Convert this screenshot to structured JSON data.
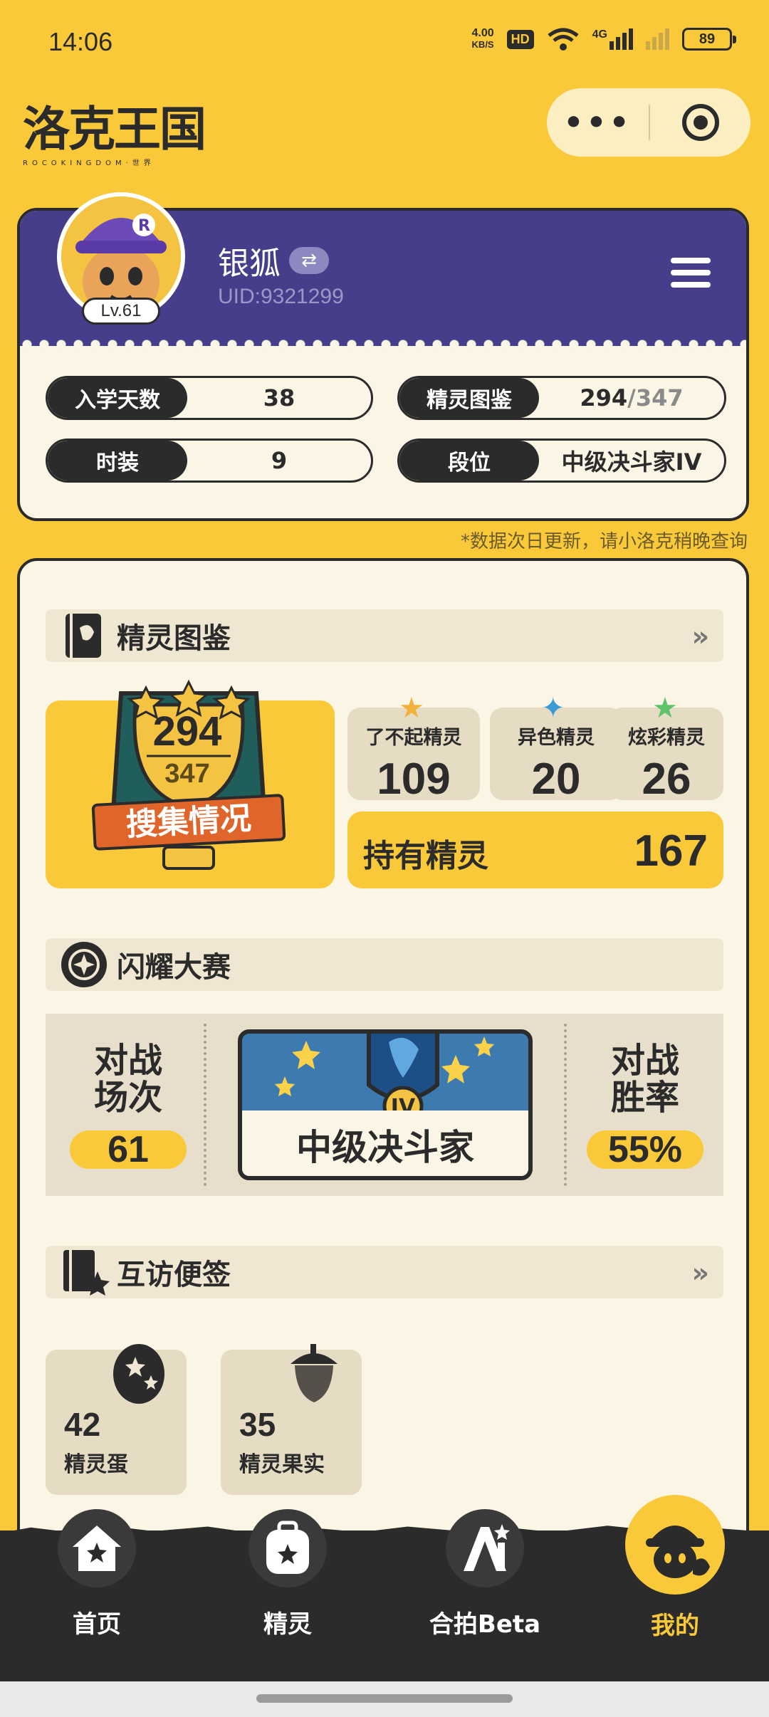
{
  "status_bar": {
    "time": "14:06",
    "net_speed_value": "4.00",
    "net_speed_unit": "KB/S",
    "hd_label": "HD",
    "signal_label": "4G",
    "battery": "89"
  },
  "app": {
    "logo_text": "洛克王国",
    "logo_sub": "ROCOKINGDOM·世界",
    "more_icon": "more-dots-icon",
    "close_icon": "target-icon"
  },
  "profile": {
    "name": "银狐",
    "uid": "UID:9321299",
    "level": "Lv.61",
    "stats": [
      {
        "label": "入学天数",
        "value": "38"
      },
      {
        "label": "精灵图鉴",
        "value": "294",
        "value_total": "/347"
      },
      {
        "label": "时装",
        "value": "9"
      },
      {
        "label": "段位",
        "value": "中级决斗家IV"
      }
    ]
  },
  "update_note": "*数据次日更新，请小洛克稍晚查询",
  "pokedex": {
    "title": "精灵图鉴",
    "more": "»",
    "collected": "294",
    "total": "347",
    "ribbon": "搜集情况",
    "categories": [
      {
        "label": "了不起精灵",
        "value": "109"
      },
      {
        "label": "异色精灵",
        "value": "20"
      },
      {
        "label": "炫彩精灵",
        "value": "26"
      }
    ],
    "owned_label": "持有精灵",
    "owned_value": "167"
  },
  "contest": {
    "title": "闪耀大赛",
    "battles_label_1": "对战",
    "battles_label_2": "场次",
    "battles_value": "61",
    "rank_name": "中级决斗家",
    "rank_tier": "IV",
    "winrate_label_1": "对战",
    "winrate_label_2": "胜率",
    "winrate_value": "55%"
  },
  "memo": {
    "title": "互访便签",
    "more": "»",
    "items": [
      {
        "count": "42",
        "name": "精灵蛋"
      },
      {
        "count": "35",
        "name": "精灵果实"
      }
    ]
  },
  "tabs": [
    {
      "label": "首页"
    },
    {
      "label": "精灵"
    },
    {
      "label": "合拍Beta"
    },
    {
      "label": "我的"
    }
  ],
  "colors": {
    "brand_yellow": "#f9c93a",
    "profile_purple": "#463e8a",
    "dark": "#2b2b2b"
  }
}
